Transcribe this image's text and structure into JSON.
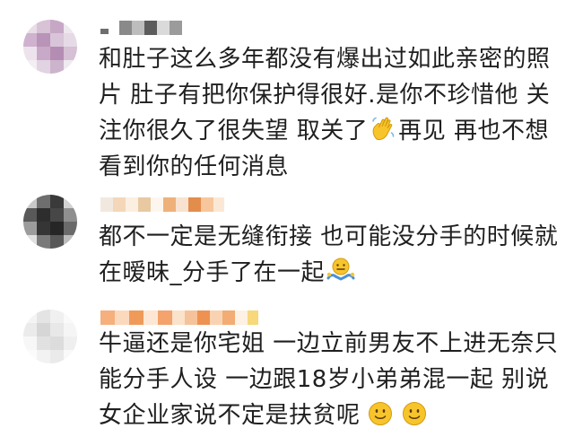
{
  "comments": [
    {
      "username": "",
      "lines": [
        "和肚子这么多年都没有爆出过如此亲密的照",
        "片 肚子有把你保护得很好.是你不珍惜他 关",
        "注你很久了很失望 取关了",
        "再见 再也不想",
        "看到你的任何消息"
      ],
      "emoji": "waving-hand"
    },
    {
      "username": "",
      "lines": [
        "都不一定是无缝衔接 也可能没分手的时候就",
        "在暧昧_分手了在一起"
      ],
      "emoji": "shrug-face"
    },
    {
      "username": "",
      "lines": [
        "牛逼还是你宅姐 一边立前男友不上进无奈只",
        "能分手人设 一边跟18岁小弟弟混一起 别说",
        "女企业家说不定是扶贫呢"
      ],
      "emoji": "smile-face"
    }
  ],
  "colors": {
    "text": "#1f1f1f",
    "background": "#ffffff",
    "emoji_yellow": "#f7c52b"
  }
}
